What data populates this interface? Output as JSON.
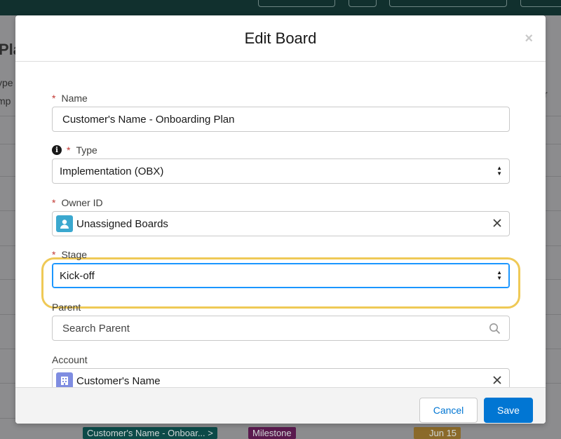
{
  "background": {
    "page_title_fragment": "Pla",
    "row_text_1": "ype",
    "row_text_2": "mp",
    "right_text": "r",
    "tags": [
      {
        "label": "Customer's Name - Onboar... >",
        "color": "#0c4a48"
      },
      {
        "label": "Milestone",
        "color": "#5a1a4e"
      },
      {
        "label": "Jun 15",
        "color": "#8b6a2a"
      }
    ]
  },
  "modal": {
    "title": "Edit Board",
    "close_symbol": "×",
    "fields": {
      "name": {
        "label": "Name",
        "required": "*",
        "value": "Customer's Name - Onboarding Plan"
      },
      "type": {
        "label": "Type",
        "required": "*",
        "info_symbol": "i",
        "value": "Implementation (OBX)"
      },
      "owner": {
        "label": "Owner ID",
        "required": "*",
        "value": "Unassigned Boards",
        "icon_color": "#3ba8cf"
      },
      "stage": {
        "label": "Stage",
        "required": "*",
        "value": "Kick-off"
      },
      "parent": {
        "label": "Parent",
        "placeholder": "Search Parent"
      },
      "account": {
        "label": "Account",
        "value": "Customer's Name",
        "icon_color": "#7f8de1"
      }
    },
    "footer": {
      "cancel_label": "Cancel",
      "save_label": "Save"
    }
  },
  "icons": {
    "clear": "close-icon",
    "search": "search-icon",
    "user": "user-icon",
    "building": "account-icon",
    "select": "select-arrows-icon"
  },
  "colors": {
    "brand": "#0176d3",
    "highlight": "#efc956",
    "required": "#c23934"
  }
}
